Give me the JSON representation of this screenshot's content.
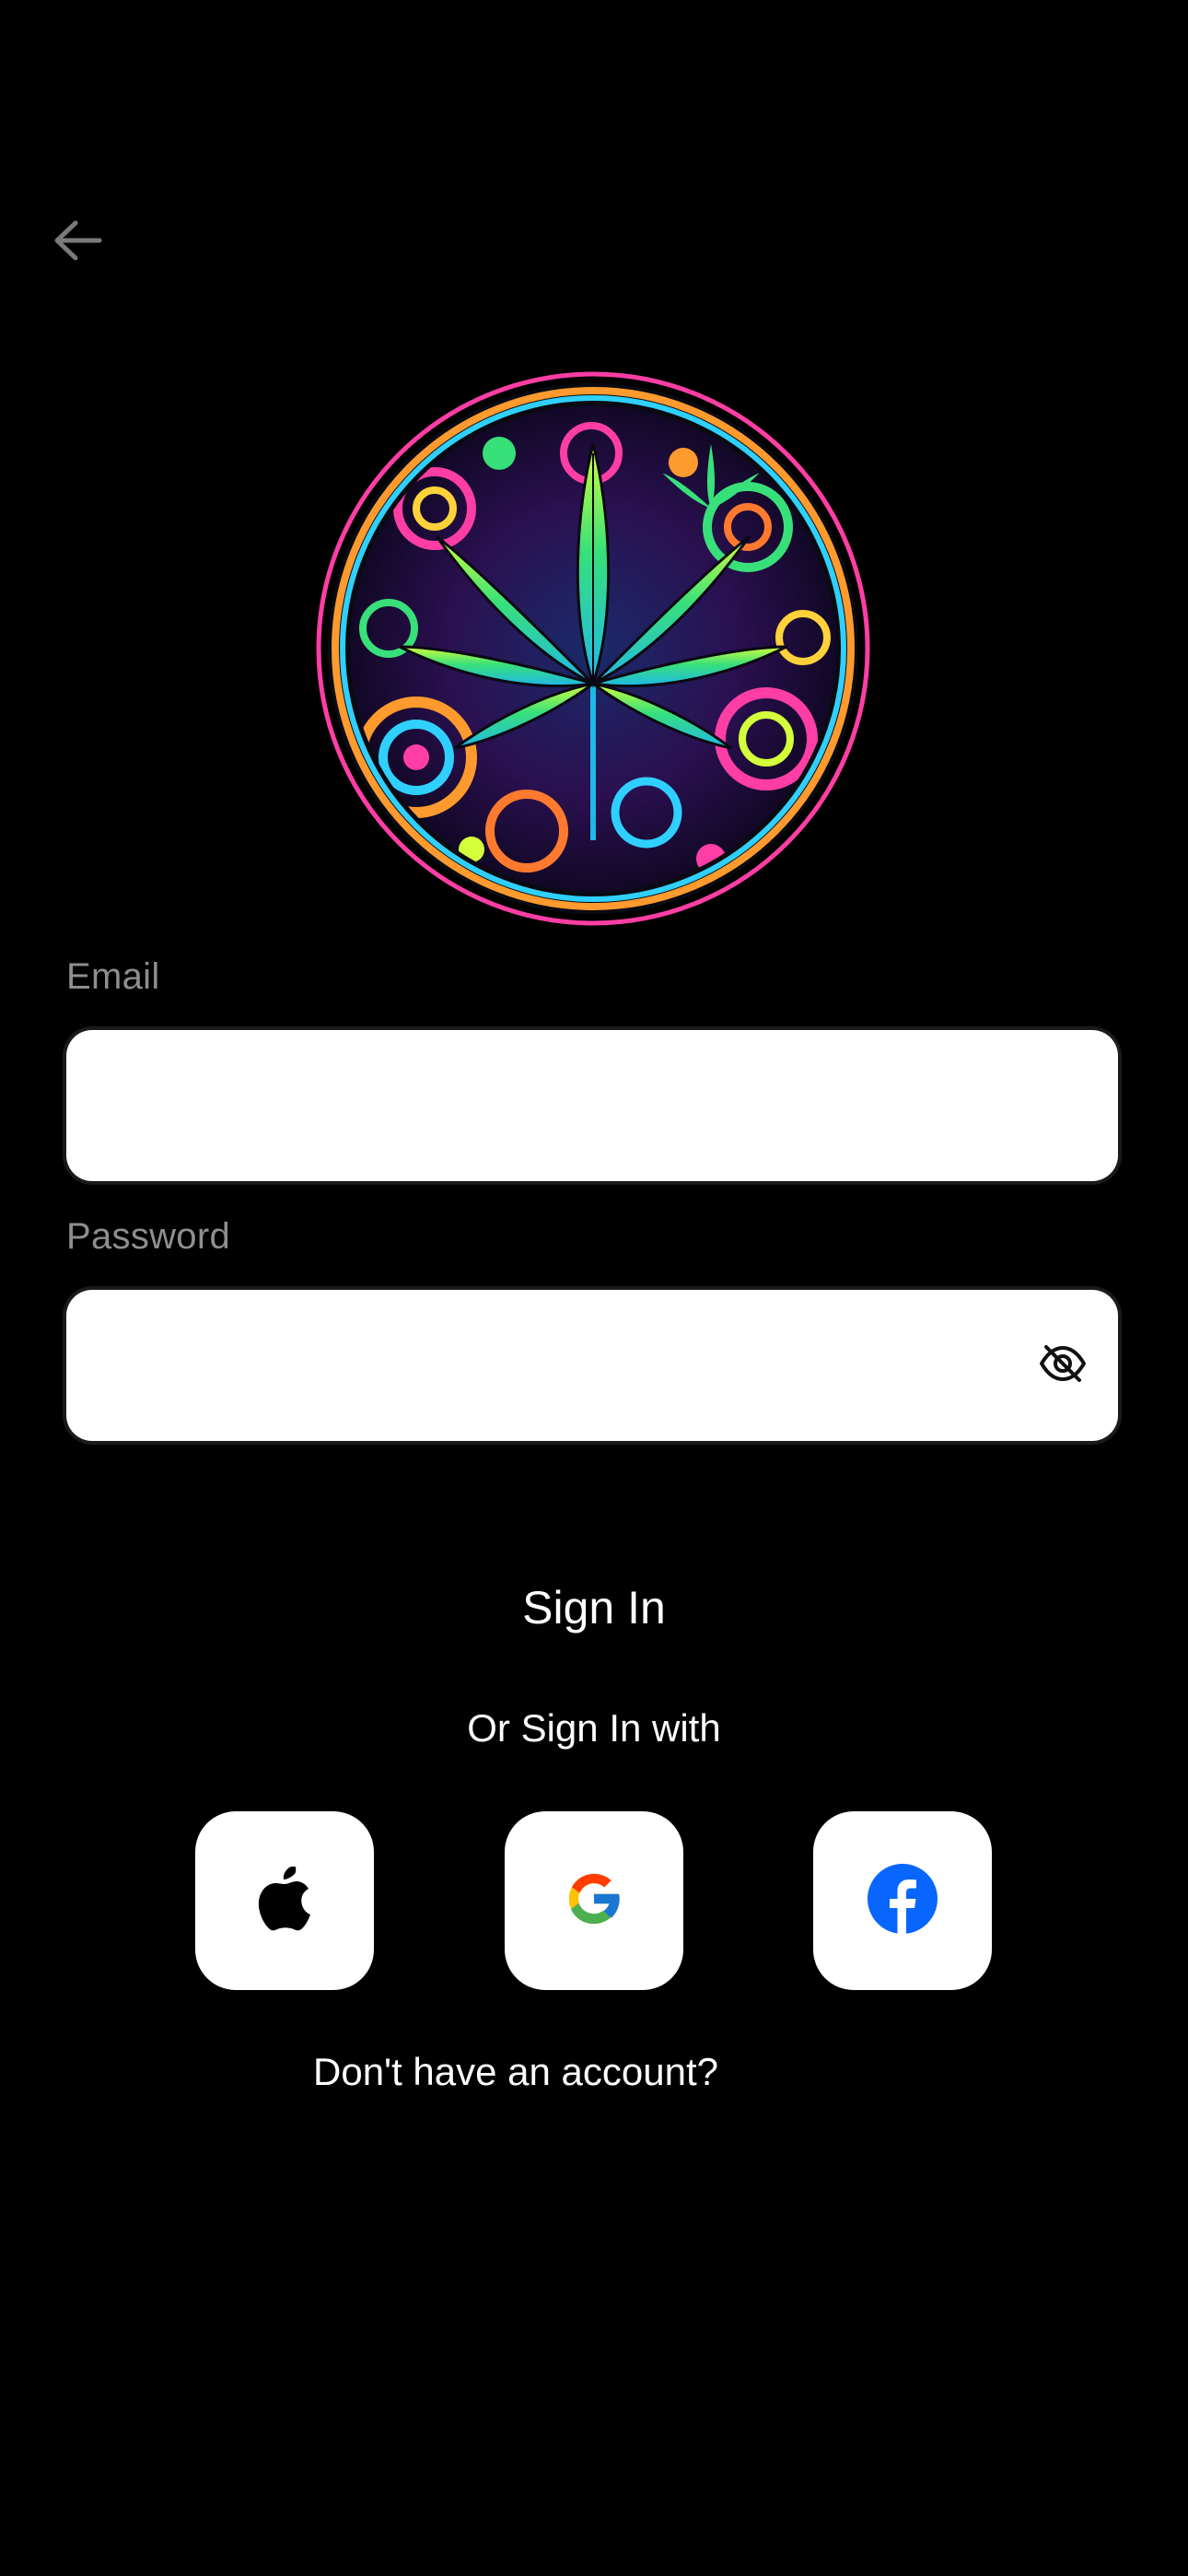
{
  "header": {
    "back_icon": "arrow-left-icon"
  },
  "logo": {
    "icon": "cannabis-leaf-psychedelic-emblem"
  },
  "form": {
    "email_label": "Email",
    "email_value": "",
    "password_label": "Password",
    "password_value": "",
    "password_toggle_icon": "eye-slash-icon",
    "signin_label": "Sign In"
  },
  "social": {
    "divider_text": "Or Sign In with",
    "providers": [
      {
        "name": "apple",
        "icon": "apple-icon"
      },
      {
        "name": "google",
        "icon": "google-icon"
      },
      {
        "name": "facebook",
        "icon": "facebook-icon"
      }
    ]
  },
  "footer": {
    "signup_prompt": "Don't have an account?"
  },
  "colors": {
    "background": "#000000",
    "label": "#8e8e8e",
    "input_bg": "#ffffff",
    "facebook_blue": "#0866ff"
  }
}
